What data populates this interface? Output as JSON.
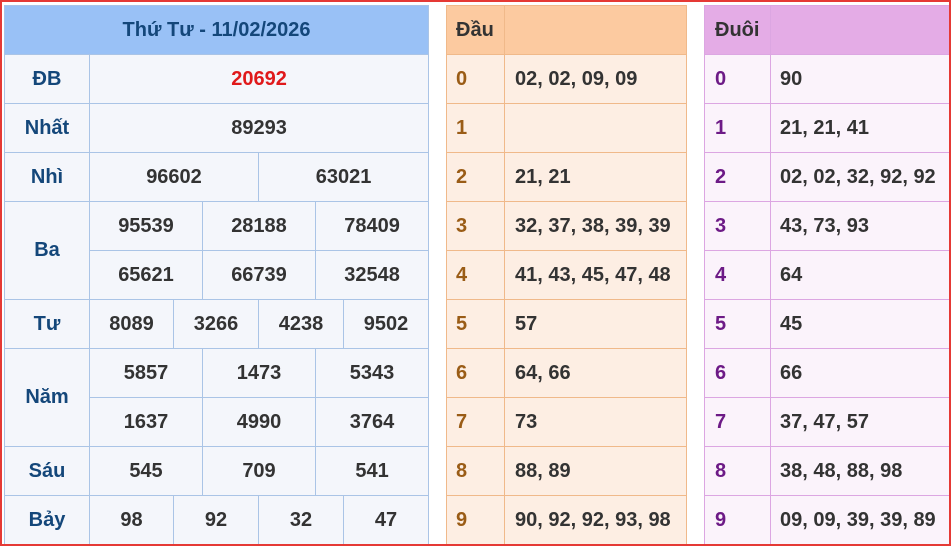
{
  "main": {
    "header": "Thứ Tư - 11/02/2026",
    "rows": [
      {
        "label": "ĐB",
        "values": [
          "20692"
        ]
      },
      {
        "label": "Nhất",
        "values": [
          "89293"
        ]
      },
      {
        "label": "Nhì",
        "values": [
          "96602",
          "63021"
        ]
      },
      {
        "label": "Ba",
        "values": [
          "95539",
          "28188",
          "78409",
          "65621",
          "66739",
          "32548"
        ]
      },
      {
        "label": "Tư",
        "values": [
          "8089",
          "3266",
          "4238",
          "9502"
        ]
      },
      {
        "label": "Năm",
        "values": [
          "5857",
          "1473",
          "5343",
          "1637",
          "4990",
          "3764"
        ]
      },
      {
        "label": "Sáu",
        "values": [
          "545",
          "709",
          "541"
        ]
      },
      {
        "label": "Bảy",
        "values": [
          "98",
          "92",
          "32",
          "47"
        ]
      }
    ]
  },
  "dau": {
    "header": "Đầu",
    "rows": [
      {
        "key": "0",
        "value": "02, 02, 09, 09"
      },
      {
        "key": "1",
        "value": ""
      },
      {
        "key": "2",
        "value": "21, 21"
      },
      {
        "key": "3",
        "value": "32, 37, 38, 39, 39"
      },
      {
        "key": "4",
        "value": "41, 43, 45, 47, 48"
      },
      {
        "key": "5",
        "value": "57"
      },
      {
        "key": "6",
        "value": "64, 66"
      },
      {
        "key": "7",
        "value": "73"
      },
      {
        "key": "8",
        "value": "88, 89"
      },
      {
        "key": "9",
        "value": "90, 92, 92, 93, 98"
      }
    ]
  },
  "duoi": {
    "header": "Đuôi",
    "rows": [
      {
        "key": "0",
        "value": "90"
      },
      {
        "key": "1",
        "value": "21, 21, 41"
      },
      {
        "key": "2",
        "value": "02, 02, 32, 92, 92"
      },
      {
        "key": "3",
        "value": "43, 73, 93"
      },
      {
        "key": "4",
        "value": "64"
      },
      {
        "key": "5",
        "value": "45"
      },
      {
        "key": "6",
        "value": "66"
      },
      {
        "key": "7",
        "value": "37, 47, 57"
      },
      {
        "key": "8",
        "value": "38, 48, 88, 98"
      },
      {
        "key": "9",
        "value": "09, 09, 39, 39, 89"
      }
    ]
  },
  "colors": {
    "frame": "#e53935",
    "main_header": "#99c1f6",
    "special_prize": "#e0191b",
    "dau_header": "#fccaa0",
    "duoi_header": "#e4ace6"
  }
}
